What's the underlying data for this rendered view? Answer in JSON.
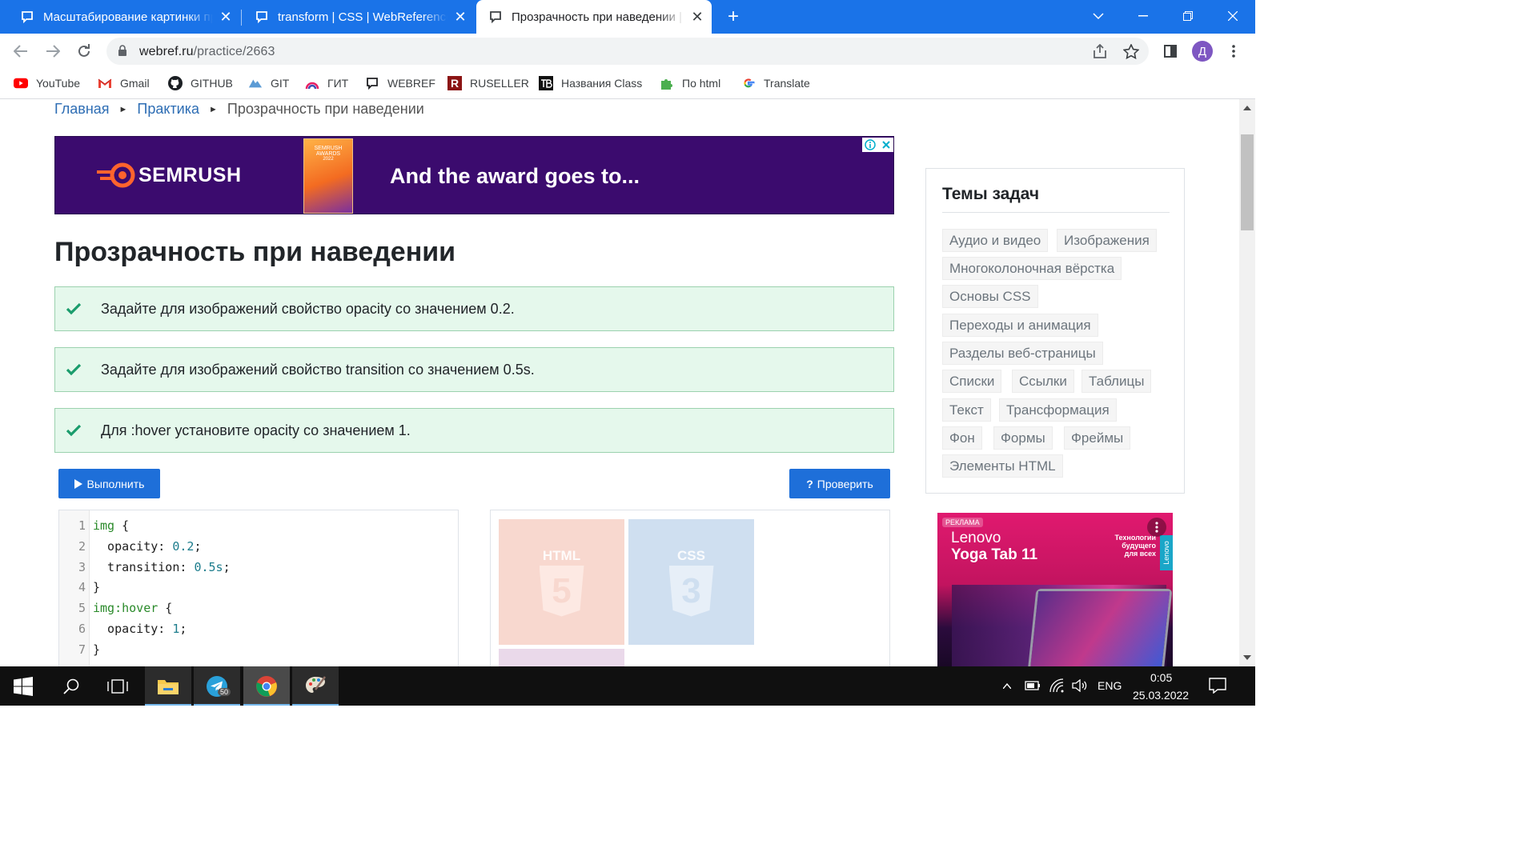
{
  "browser": {
    "tabs": [
      {
        "title": "Масштабирование картинки пр",
        "active": false
      },
      {
        "title": "transform | CSS | WebReference",
        "active": false
      },
      {
        "title": "Прозрачность при наведении |",
        "active": true
      }
    ],
    "new_tab_label": "+",
    "url_host": "webref.ru",
    "url_path": "/practice/2663",
    "avatar_letter": "Д",
    "bookmarks": [
      {
        "label": "YouTube",
        "icon": "youtube-icon"
      },
      {
        "label": "Gmail",
        "icon": "gmail-icon"
      },
      {
        "label": "GITHUB",
        "icon": "github-icon"
      },
      {
        "label": "GIT",
        "icon": "git-icon"
      },
      {
        "label": "ГИТ",
        "icon": "git-rainbow-icon"
      },
      {
        "label": "WEBREF",
        "icon": "webref-icon"
      },
      {
        "label": "RUSELLER",
        "icon": "ruseller-icon"
      },
      {
        "label": "Названия Class",
        "icon": "tb-icon"
      },
      {
        "label": "По html",
        "icon": "puzzle-icon"
      },
      {
        "label": "Translate",
        "icon": "google-icon"
      }
    ]
  },
  "page": {
    "breadcrumb": {
      "home": "Главная",
      "section": "Практика",
      "current": "Прозрачность при наведении",
      "separator": "►"
    },
    "ad_banner": {
      "brand": "SEMRUSH",
      "award_line1": "SEMRUSH",
      "award_line2": "AWARDS",
      "award_year": "2022",
      "headline": "And the award goes to..."
    },
    "title": "Прозрачность при наведении",
    "tasks": [
      {
        "text": "Задайте для изображений свойство opacity со значением 0.2.",
        "done": true
      },
      {
        "text": "Задайте для изображений свойство transition со значением 0.5s.",
        "done": true
      },
      {
        "text": "Для :hover установите opacity со значением 1.",
        "done": true
      }
    ],
    "run_button": "Выполнить",
    "check_button": "Проверить",
    "code_lines": [
      {
        "n": "1"
      },
      {
        "n": "2"
      },
      {
        "n": "3"
      },
      {
        "n": "4"
      },
      {
        "n": "5"
      },
      {
        "n": "6"
      },
      {
        "n": "7"
      }
    ],
    "code": {
      "l1_sel": "img",
      "l1_rest": " {",
      "l2_prop": "  opacity: ",
      "l2_val": "0.2",
      "l2_end": ";",
      "l3_prop": "  transition: ",
      "l3_val": "0.5s",
      "l3_end": ";",
      "l4": "}",
      "l5_sel": "img",
      "l5_pseudo": ":hover",
      "l5_rest": " {",
      "l6_prop": "  opacity: ",
      "l6_val": "1",
      "l6_end": ";",
      "l7": "}"
    },
    "preview": {
      "html_label": "HTML",
      "html_num": "5",
      "css_label": "CSS",
      "css_num": "3"
    }
  },
  "sidebar": {
    "title": "Темы задач",
    "topics": [
      "Аудио и видео",
      "Изображения",
      "Многоколоночная вёрстка",
      "Основы CSS",
      "Переходы и анимация",
      "Разделы веб-страницы",
      "Списки",
      "Ссылки",
      "Таблицы",
      "Текст",
      "Трансформация",
      "Фон",
      "Формы",
      "Фреймы",
      "Элементы HTML"
    ],
    "ad": {
      "label": "РЕКЛАМА",
      "brand": "Lenovo",
      "product": "Yoga Tab 11",
      "slogan_1": "Технологии",
      "slogan_2": "будущего",
      "slogan_3": "для всех",
      "vertical_brand": "Lenovo"
    }
  },
  "taskbar": {
    "telegram_badge": "50",
    "language": "ENG",
    "time": "0:05",
    "date": "25.03.2022"
  },
  "colors": {
    "chrome_blue": "#1a73e8",
    "task_bg": "#e5f8ec",
    "task_border": "#9bd1ae",
    "check_green": "#1a9c6c",
    "button_blue": "#1e6fd9",
    "link": "#2d6db4",
    "ad_purple": "#3b0b6e",
    "semrush_orange": "#ff642d"
  }
}
